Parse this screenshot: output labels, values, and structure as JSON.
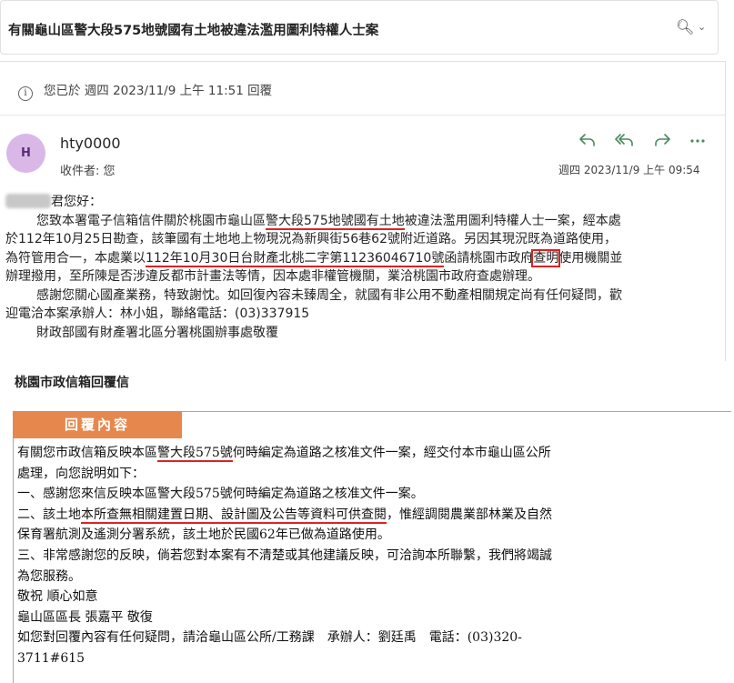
{
  "header": {
    "subject": "有關龜山區警大段575地號國有土地被違法濫用圖利特權人士案",
    "zoom_icon": "zoom-icon",
    "chevron": "⌄"
  },
  "reply_info": {
    "icon": "ⓘ",
    "text": "您已於 週四 2023/11/9 上午 11:51 回覆"
  },
  "message": {
    "avatar_initial": "H",
    "sender": "hty0000",
    "recipient": "收件者:  您",
    "date": "週四 2023/11/9 上午 09:54",
    "actions": [
      "reply",
      "reply-all",
      "forward",
      "more"
    ],
    "greeting": "君您好：",
    "p1": {
      "a": "您致本署電子信箱信件關於桃園市龜山區",
      "u1": "警大段575地號國有土地",
      "b": "被違法濫用圖利特權人士一案，經本處",
      "line2": "於112年10月25日勘查，該筆國有土地地上物現況為新興街56巷62號附近道路。另因其現況既為道路使用，",
      "c": "為符管用合一，本處業以",
      "u2": "112年10月30日台財產北桃二字第11236046710號",
      "d": "函請桃園市政府",
      "boxed": "查明",
      "e": "使用機關並",
      "line4": "辦理撥用，至所陳是否涉違反都市計畫法等情，因本處非權管機關，業洽桃園市政府查處辦理。"
    },
    "p2a": "感謝您關心國產業務，特致謝忱。如回復內容未臻周全，就國有非公用不動產相關規定尚有任何疑問，歡",
    "p2b": "迎電洽本案承辦人：林小姐，聯絡電話：(03)337915",
    "signature": "財政部國有財產署北區分署桃園辦事處敬覆"
  },
  "reply_section": {
    "title": "桃園市政信箱回覆信",
    "tab": "回覆內容",
    "l1a": "有關您市政信箱反映本區",
    "l1u": "警大段575號",
    "l1b": "何時編定為道路之核准文件一案，經交付本市龜山區公所",
    "l2": "處理，向您說明如下：",
    "l3": "一、感謝您來信反映本區警大段575號何時編定為道路之核准文件一案。",
    "l4a": "二、該土地",
    "l4u": "本所查無相關建置日期、設計圖及公告等資料可供查閱",
    "l4b": "，惟經調閱農業部林業及自然",
    "l5": "保育署航測及遙測分署系統，該土地於民國62年已做為道路使用。",
    "l6": "三、非常感謝您的反映，倘若您對本案有不清楚或其他建議反映，可洽詢本所聯繫，我們將竭誠",
    "l7": "為您服務。",
    "l8": "敬祝 順心如意",
    "l9": "龜山區區長 張嘉平 敬復",
    "l10": "如您對回覆內容有任何疑問，請洽龜山區公所/工務課　承辦人：劉廷禹　電話：(03)320-",
    "l11": "3711#615"
  }
}
